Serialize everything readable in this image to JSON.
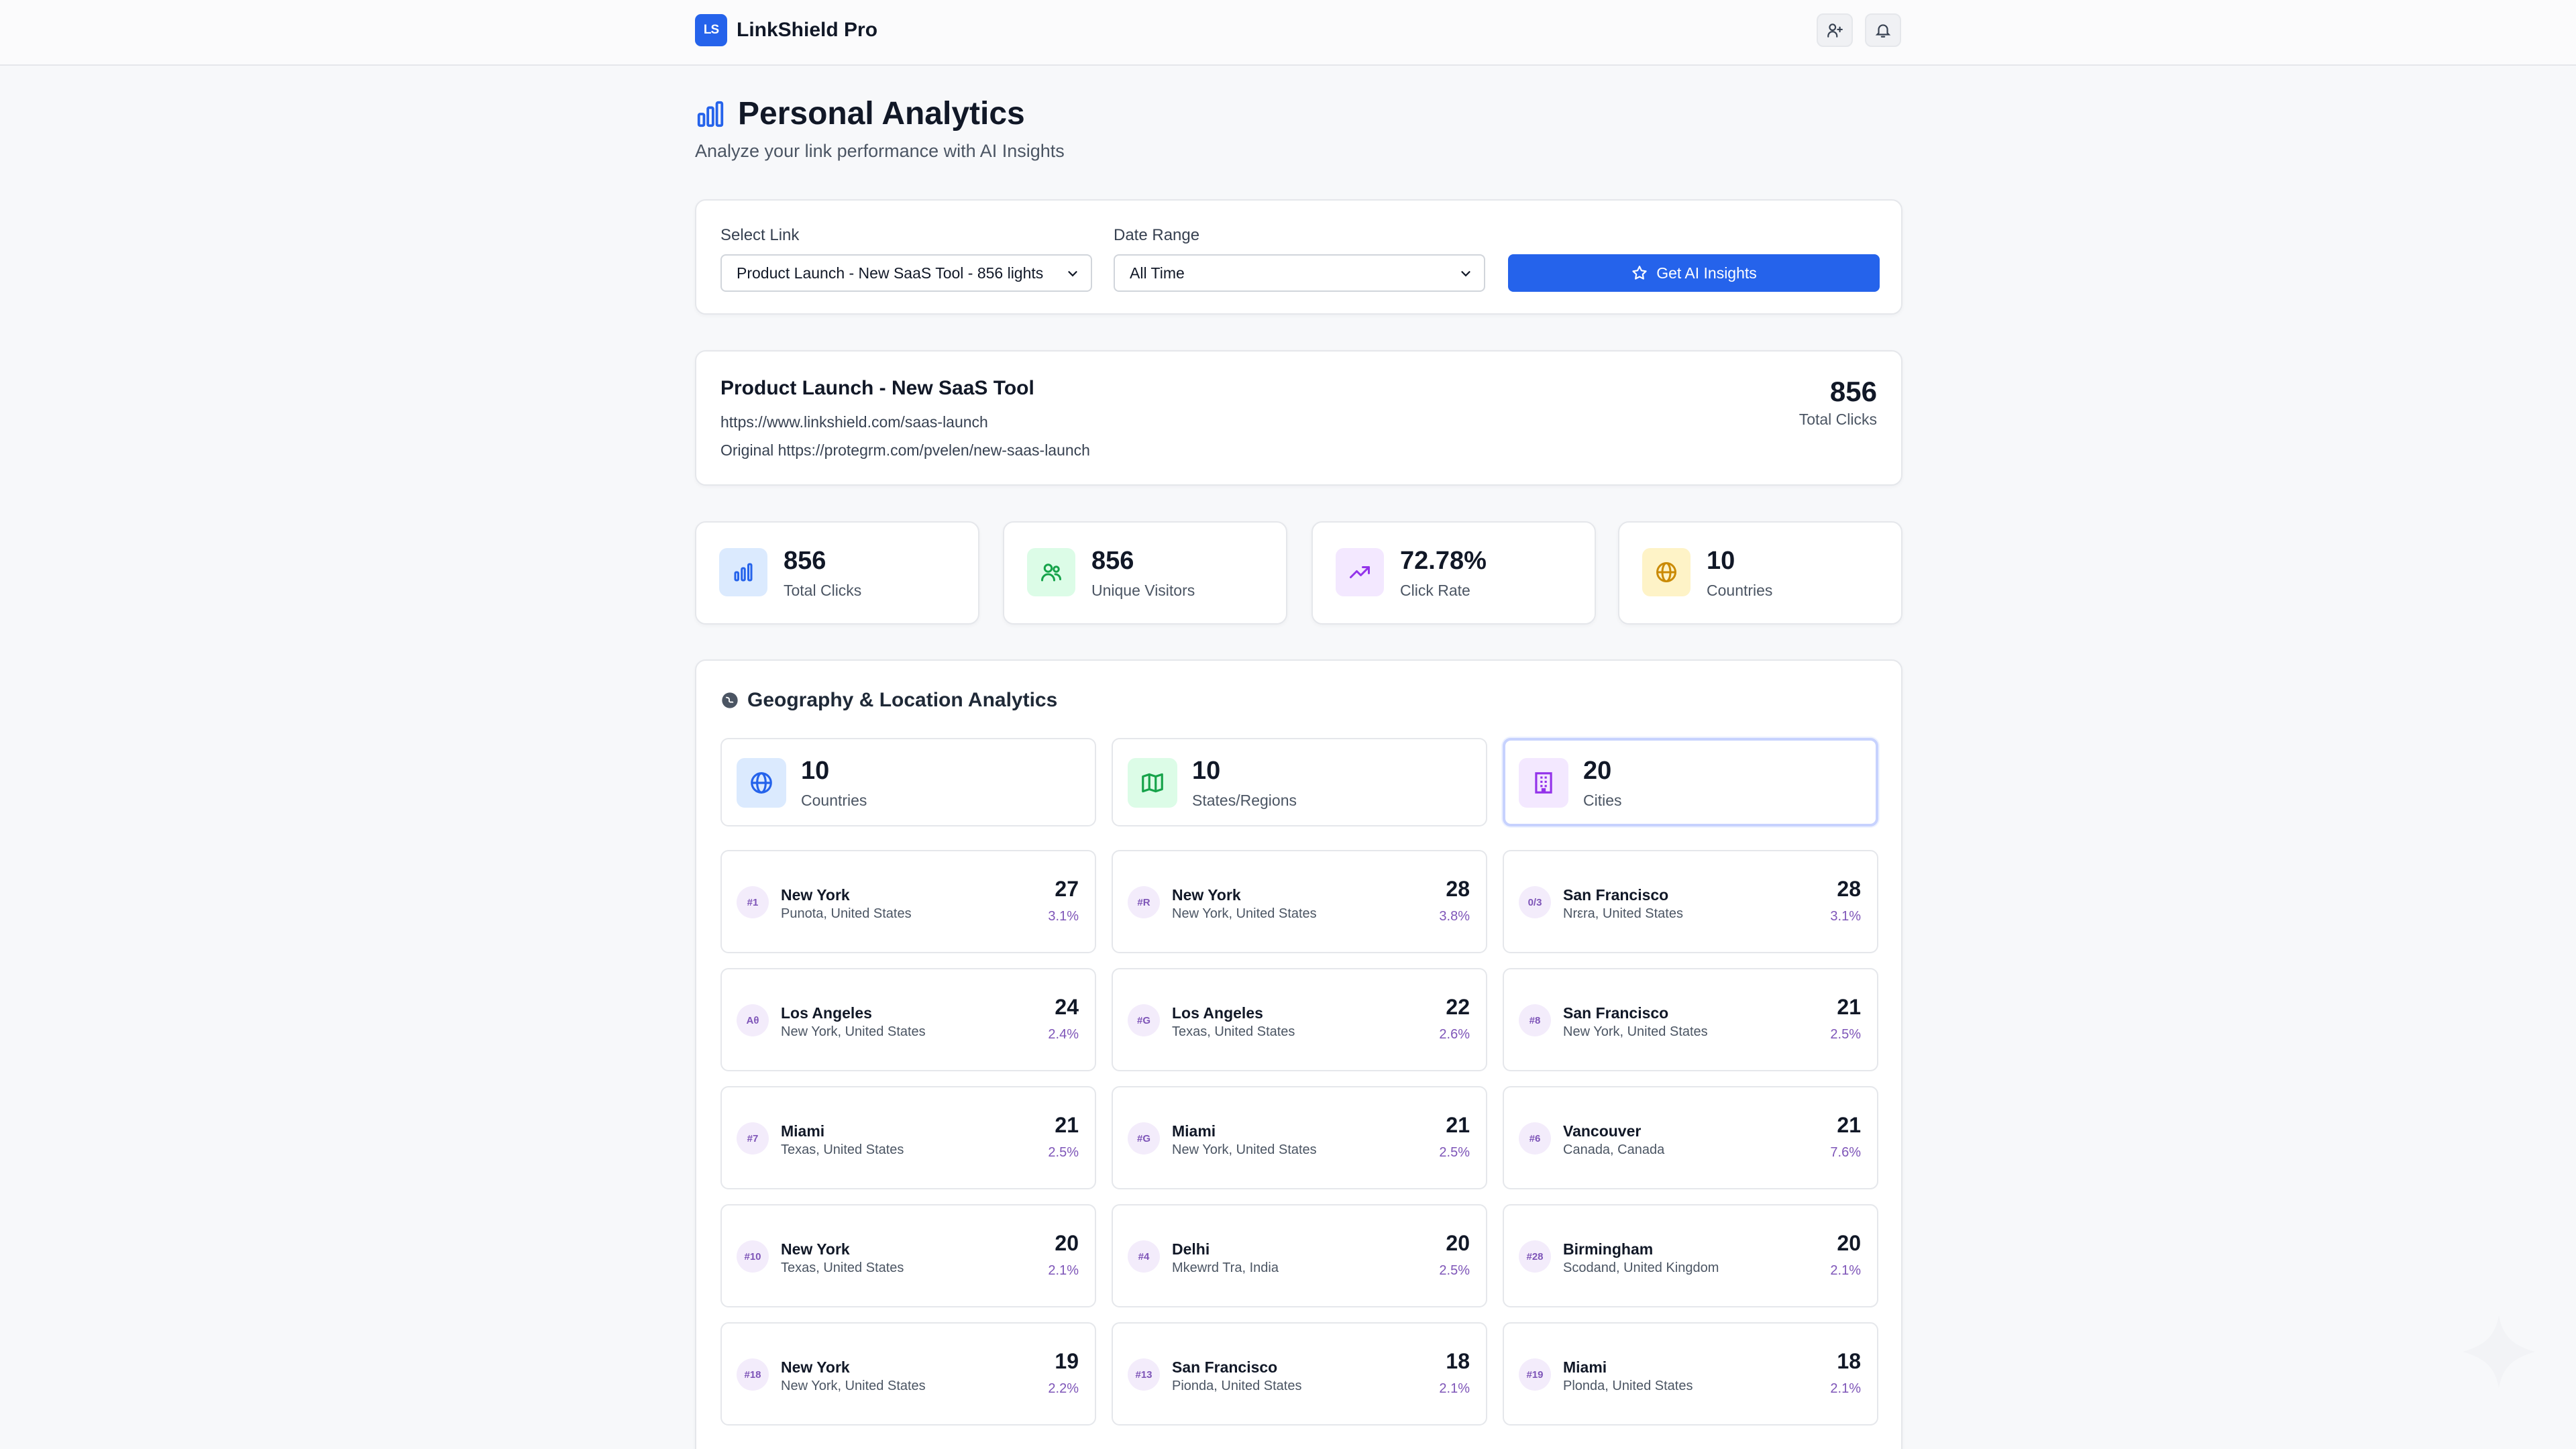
{
  "app": {
    "logo_text": "LS",
    "name": "LinkShield Pro"
  },
  "header": {
    "icons": [
      "user-add-icon",
      "bell-icon"
    ]
  },
  "page": {
    "title": "Personal Analytics",
    "subtitle": "Analyze your link performance with AI Insights"
  },
  "filters": {
    "select_link_label": "Select Link",
    "select_link_value": "Product Launch - New SaaS Tool - 856 lights",
    "date_range_label": "Date Range",
    "date_range_value": "All Time",
    "ai_button_label": "Get AI Insights"
  },
  "link": {
    "title": "Product Launch - New SaaS Tool",
    "short_url": "https://www.linkshield.com/saas-launch",
    "original_url": "Original https://protegrm.com/pvelen/new-saas-launch",
    "total_clicks": "856",
    "total_clicks_label": "Total Clicks"
  },
  "stats": [
    {
      "value": "856",
      "label": "Total Clicks",
      "icon": "bar-chart-icon",
      "color": "#2563eb",
      "bg": "#dbeafe"
    },
    {
      "value": "856",
      "label": "Unique Visitors",
      "icon": "users-icon",
      "color": "#16a34a",
      "bg": "#dcfce7"
    },
    {
      "value": "72.78%",
      "label": "Click Rate",
      "icon": "trending-up-icon",
      "color": "#9333ea",
      "bg": "#f3e8ff"
    },
    {
      "value": "10",
      "label": "Countries",
      "icon": "globe-icon",
      "color": "#ca8a04",
      "bg": "#fef3c7"
    }
  ],
  "geo": {
    "title": "Geography & Location Analytics",
    "summary": [
      {
        "value": "10",
        "label": "Countries",
        "icon": "globe-icon",
        "color": "#2563eb",
        "bg": "#dbeafe"
      },
      {
        "value": "10",
        "label": "States/Regions",
        "icon": "map-icon",
        "color": "#16a34a",
        "bg": "#dcfce7"
      },
      {
        "value": "20",
        "label": "Cities",
        "icon": "building-icon",
        "color": "#9333ea",
        "bg": "#f3e8ff"
      }
    ],
    "locations": [
      [
        {
          "rank": "#1",
          "city": "New York",
          "region": "Punota, United States",
          "count": "27",
          "pct": "3.1%"
        },
        {
          "rank": "Aθ",
          "city": "Los Angeles",
          "region": "New York, United States",
          "count": "24",
          "pct": "2.4%"
        },
        {
          "rank": "#7",
          "city": "Miami",
          "region": "Texas, United States",
          "count": "21",
          "pct": "2.5%"
        },
        {
          "rank": "#10",
          "city": "New York",
          "region": "Texas, United States",
          "count": "20",
          "pct": "2.1%"
        },
        {
          "rank": "#18",
          "city": "New York",
          "region": "New York, United States",
          "count": "19",
          "pct": "2.2%"
        }
      ],
      [
        {
          "rank": "#R",
          "city": "New York",
          "region": "New York, United States",
          "count": "28",
          "pct": "3.8%"
        },
        {
          "rank": "#G",
          "city": "Los Angeles",
          "region": "Texas, United States",
          "count": "22",
          "pct": "2.6%"
        },
        {
          "rank": "#G",
          "city": "Miami",
          "region": "New York, United States",
          "count": "21",
          "pct": "2.5%"
        },
        {
          "rank": "#4",
          "city": "Delhi",
          "region": "Μkewrd Tra, India",
          "count": "20",
          "pct": "2.5%"
        },
        {
          "rank": "#13",
          "city": "San Francisco",
          "region": "Pionda, United States",
          "count": "18",
          "pct": "2.1%"
        }
      ],
      [
        {
          "rank": "0/3",
          "city": "San Francisco",
          "region": "Nrεra, United States",
          "count": "28",
          "pct": "3.1%"
        },
        {
          "rank": "#8",
          "city": "San Francisco",
          "region": "New York, United States",
          "count": "21",
          "pct": "2.5%"
        },
        {
          "rank": "#6",
          "city": "Vancouver",
          "region": "Canada, Canada",
          "count": "21",
          "pct": "7.6%"
        },
        {
          "rank": "#28",
          "city": "Birmingham",
          "region": "Scodand, United Kingdom",
          "count": "20",
          "pct": "2.1%"
        },
        {
          "rank": "#19",
          "city": "Miami",
          "region": "Plonda, United States",
          "count": "18",
          "pct": "2.1%"
        }
      ]
    ]
  }
}
